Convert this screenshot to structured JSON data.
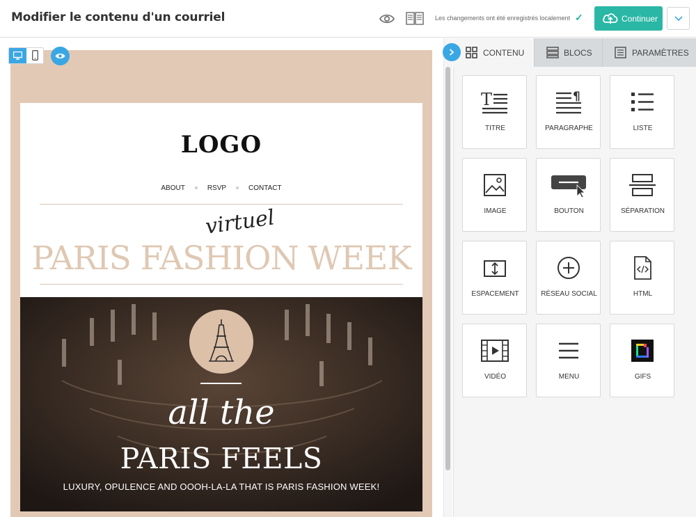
{
  "header": {
    "title": "Modifier le contenu d'un courriel",
    "saved_status": "Les changements ont été enregistrés localement",
    "continue_label": "Continuer"
  },
  "colors": {
    "accent_teal": "#2ab7a5",
    "accent_blue": "#3aa7e4",
    "email_background": "#e2c9b5"
  },
  "email": {
    "logo": "LOGO",
    "nav": [
      "ABOUT",
      "RSVP",
      "CONTACT"
    ],
    "script_word": "virtuel",
    "headline": "PARIS FASHION WEEK",
    "hero_script": "all the",
    "hero_title": "PARIS FEELS",
    "hero_subtitle": "LUXURY, OPULENCE AND OOOH-LA-LA THAT IS PARIS FASHION WEEK!"
  },
  "tabs": [
    {
      "label": "CONTENU",
      "icon": "grid-icon",
      "active": true
    },
    {
      "label": "BLOCS",
      "icon": "blocks-icon",
      "active": false
    },
    {
      "label": "PARAMÈTRES",
      "icon": "settings-doc-icon",
      "active": false
    }
  ],
  "blocks": [
    {
      "label": "TITRE",
      "icon": "title-icon"
    },
    {
      "label": "PARAGRAPHE",
      "icon": "paragraph-icon"
    },
    {
      "label": "LISTE",
      "icon": "list-icon"
    },
    {
      "label": "IMAGE",
      "icon": "image-icon"
    },
    {
      "label": "BOUTON",
      "icon": "button-icon"
    },
    {
      "label": "SÉPARATION",
      "icon": "separator-icon"
    },
    {
      "label": "ESPACEMENT",
      "icon": "spacing-icon"
    },
    {
      "label": "RÉSEAU SOCIAL",
      "icon": "social-plus-icon"
    },
    {
      "label": "HTML",
      "icon": "html-file-icon"
    },
    {
      "label": "VIDÉO",
      "icon": "video-icon"
    },
    {
      "label": "MENU",
      "icon": "menu-icon"
    },
    {
      "label": "GIFS",
      "icon": "gifs-icon"
    }
  ]
}
